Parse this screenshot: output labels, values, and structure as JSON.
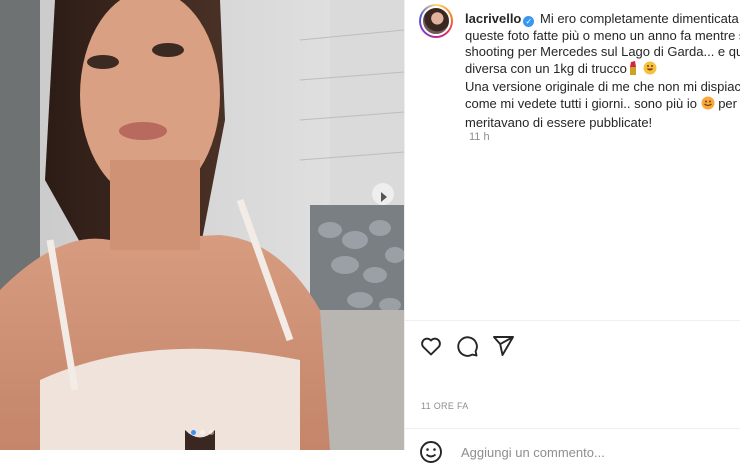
{
  "post": {
    "username": "lacrivello",
    "verified_icon": "verified-badge-icon",
    "caption_lines": [
      "Mi ero completamente dimenticata di",
      "queste foto fatte più o meno un anno fa mentre s",
      "shooting per Mercedes sul Lago di Garda... e qua",
      "diversa con un 1kg di trucco",
      "Una versione originale di me che non mi dispiace",
      "come mi vedete tutti i giorni.. sono più io",
      "meritavano di essere pubblicate!"
    ],
    "caption_line7_tail": "per",
    "time_ago": "11 h",
    "date_label": "11 ORE FA"
  },
  "icons": {
    "like": "heart-icon",
    "comment": "comment-icon",
    "share": "share-icon",
    "next": "chevron-right-icon",
    "emoji": "smiley-icon"
  },
  "comment": {
    "placeholder": "Aggiungi un commento..."
  },
  "carousel": {
    "total": 3,
    "active_index": 0
  },
  "colors": {
    "accent_blue": "#3897f0",
    "text": "#262626",
    "muted": "#8e8e8e"
  }
}
